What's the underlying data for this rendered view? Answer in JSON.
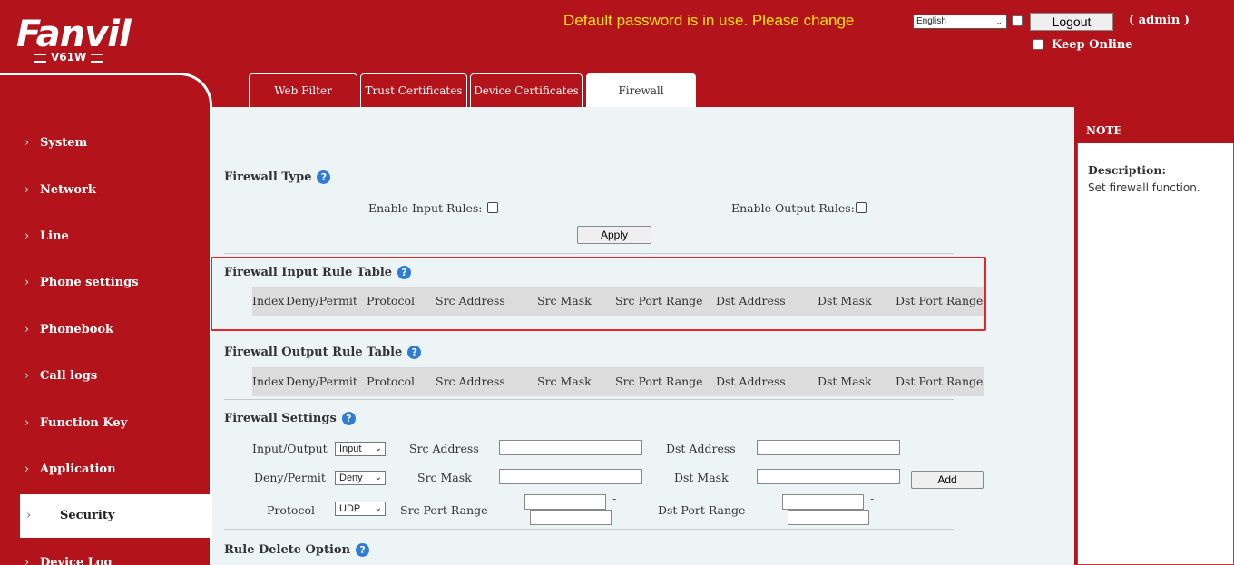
{
  "brand": {
    "logo": "Fanvil",
    "model": "V61W"
  },
  "header": {
    "warning": "Default password is in use. Please change",
    "language": "English",
    "logout_label": "Logout",
    "user": "( admin )",
    "keep_online": "Keep Online"
  },
  "tabs": [
    {
      "label": "Web Filter"
    },
    {
      "label": "Trust Certificates"
    },
    {
      "label": "Device Certificates"
    },
    {
      "label": "Firewall"
    }
  ],
  "active_tab": "Firewall",
  "sidebar": {
    "items": [
      {
        "label": "System"
      },
      {
        "label": "Network"
      },
      {
        "label": "Line"
      },
      {
        "label": "Phone settings"
      },
      {
        "label": "Phonebook"
      },
      {
        "label": "Call logs"
      },
      {
        "label": "Function Key"
      },
      {
        "label": "Application"
      },
      {
        "label": "Security"
      },
      {
        "label": "Device Log"
      }
    ],
    "active": "Security"
  },
  "firewall_type": {
    "title": "Firewall Type",
    "enable_input_label": "Enable Input Rules:",
    "enable_output_label": "Enable Output Rules:",
    "apply_label": "Apply"
  },
  "input_table": {
    "title": "Firewall Input Rule Table",
    "columns": [
      "Index",
      "Deny/Permit",
      "Protocol",
      "Src Address",
      "Src Mask",
      "Src Port Range",
      "Dst Address",
      "Dst Mask",
      "Dst Port Range"
    ]
  },
  "output_table": {
    "title": "Firewall Output Rule Table",
    "columns": [
      "Index",
      "Deny/Permit",
      "Protocol",
      "Src Address",
      "Src Mask",
      "Src Port Range",
      "Dst Address",
      "Dst Mask",
      "Dst Port Range"
    ]
  },
  "settings": {
    "title": "Firewall Settings",
    "input_output_label": "Input/Output",
    "input_output_value": "Input",
    "deny_permit_label": "Deny/Permit",
    "deny_permit_value": "Deny",
    "protocol_label": "Protocol",
    "protocol_value": "UDP",
    "src_address_label": "Src Address",
    "src_mask_label": "Src Mask",
    "src_port_range_label": "Src Port Range",
    "dst_address_label": "Dst Address",
    "dst_mask_label": "Dst Mask",
    "dst_port_range_label": "Dst Port Range",
    "range_separator": "-",
    "add_label": "Add"
  },
  "rule_delete": {
    "title": "Rule Delete Option"
  },
  "note": {
    "header": "NOTE",
    "description_title": "Description:",
    "description": "Set firewall function."
  },
  "colors": {
    "brand_red": "#b3131b",
    "warning_yellow": "#ffe400",
    "highlight_red": "#e5242b",
    "help_blue": "#2f7cd4"
  }
}
